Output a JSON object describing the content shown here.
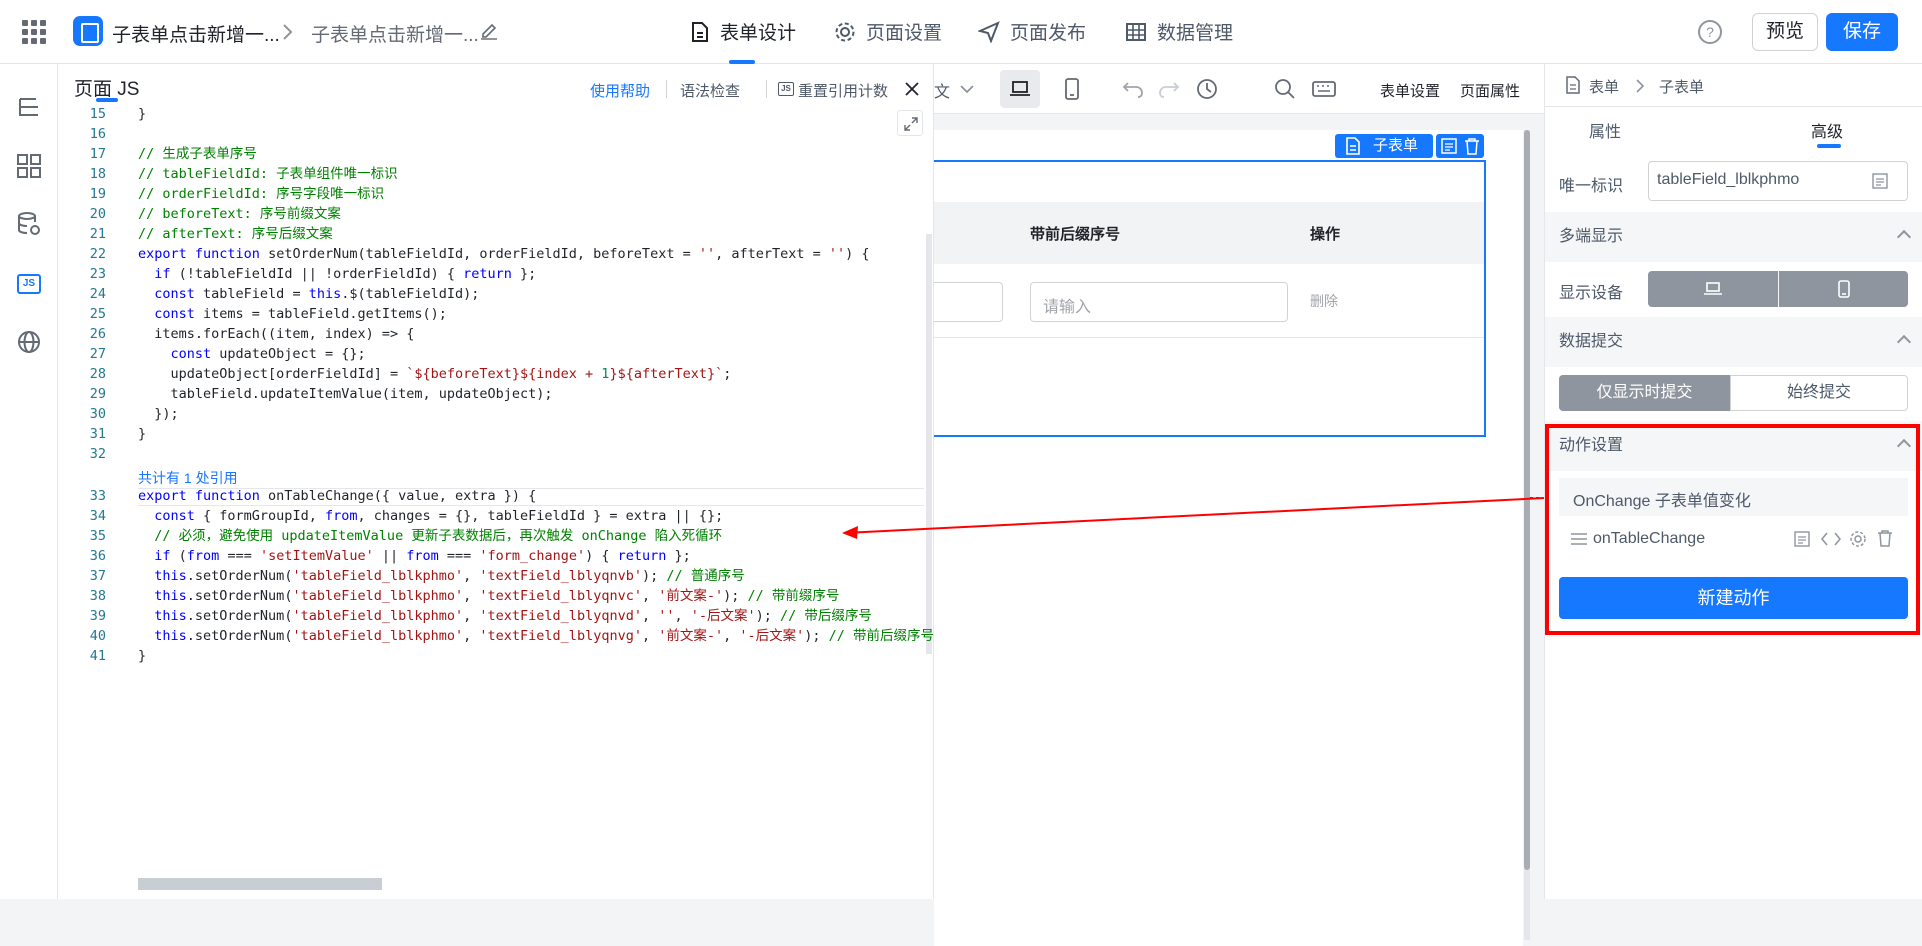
{
  "topbar": {
    "app_name": "子表单点击新增一...",
    "page_name": "子表单点击新增一...",
    "tabs": [
      "表单设计",
      "页面设置",
      "页面发布",
      "数据管理"
    ],
    "help": "?",
    "preview": "预览",
    "save": "保存"
  },
  "code_panel": {
    "title": "页面 JS",
    "help_link": "使用帮助",
    "syntax_check": "语法检查",
    "reset_ref_count": "重置引用计数",
    "ref_count_hint": "共计有 1 处引用"
  },
  "canvas_toolbar": {
    "form_settings": "表单设置",
    "page_props": "页面属性",
    "partial_char": "文"
  },
  "form_canvas": {
    "subform_tag": "子表单",
    "columns": [
      "带前后缀序号",
      "操作"
    ],
    "placeholder": "请输入",
    "delete": "删除"
  },
  "right_panel": {
    "breadcrumb": [
      "表单",
      "子表单"
    ],
    "tabs": [
      "属性",
      "高级"
    ],
    "uid_label": "唯一标识",
    "uid_value": "tableField_lblkphmo",
    "multi_display": "多端显示",
    "display_device": "显示设备",
    "data_submit": "数据提交",
    "submit_opts": [
      "仅显示时提交",
      "始终提交"
    ],
    "action_settings": "动作设置",
    "onchange_title": "OnChange 子表单值变化",
    "action_name": "onTableChange",
    "new_action": "新建动作"
  },
  "colors": {
    "accent": "#1677ff",
    "highlight_red": "#ff0000"
  }
}
